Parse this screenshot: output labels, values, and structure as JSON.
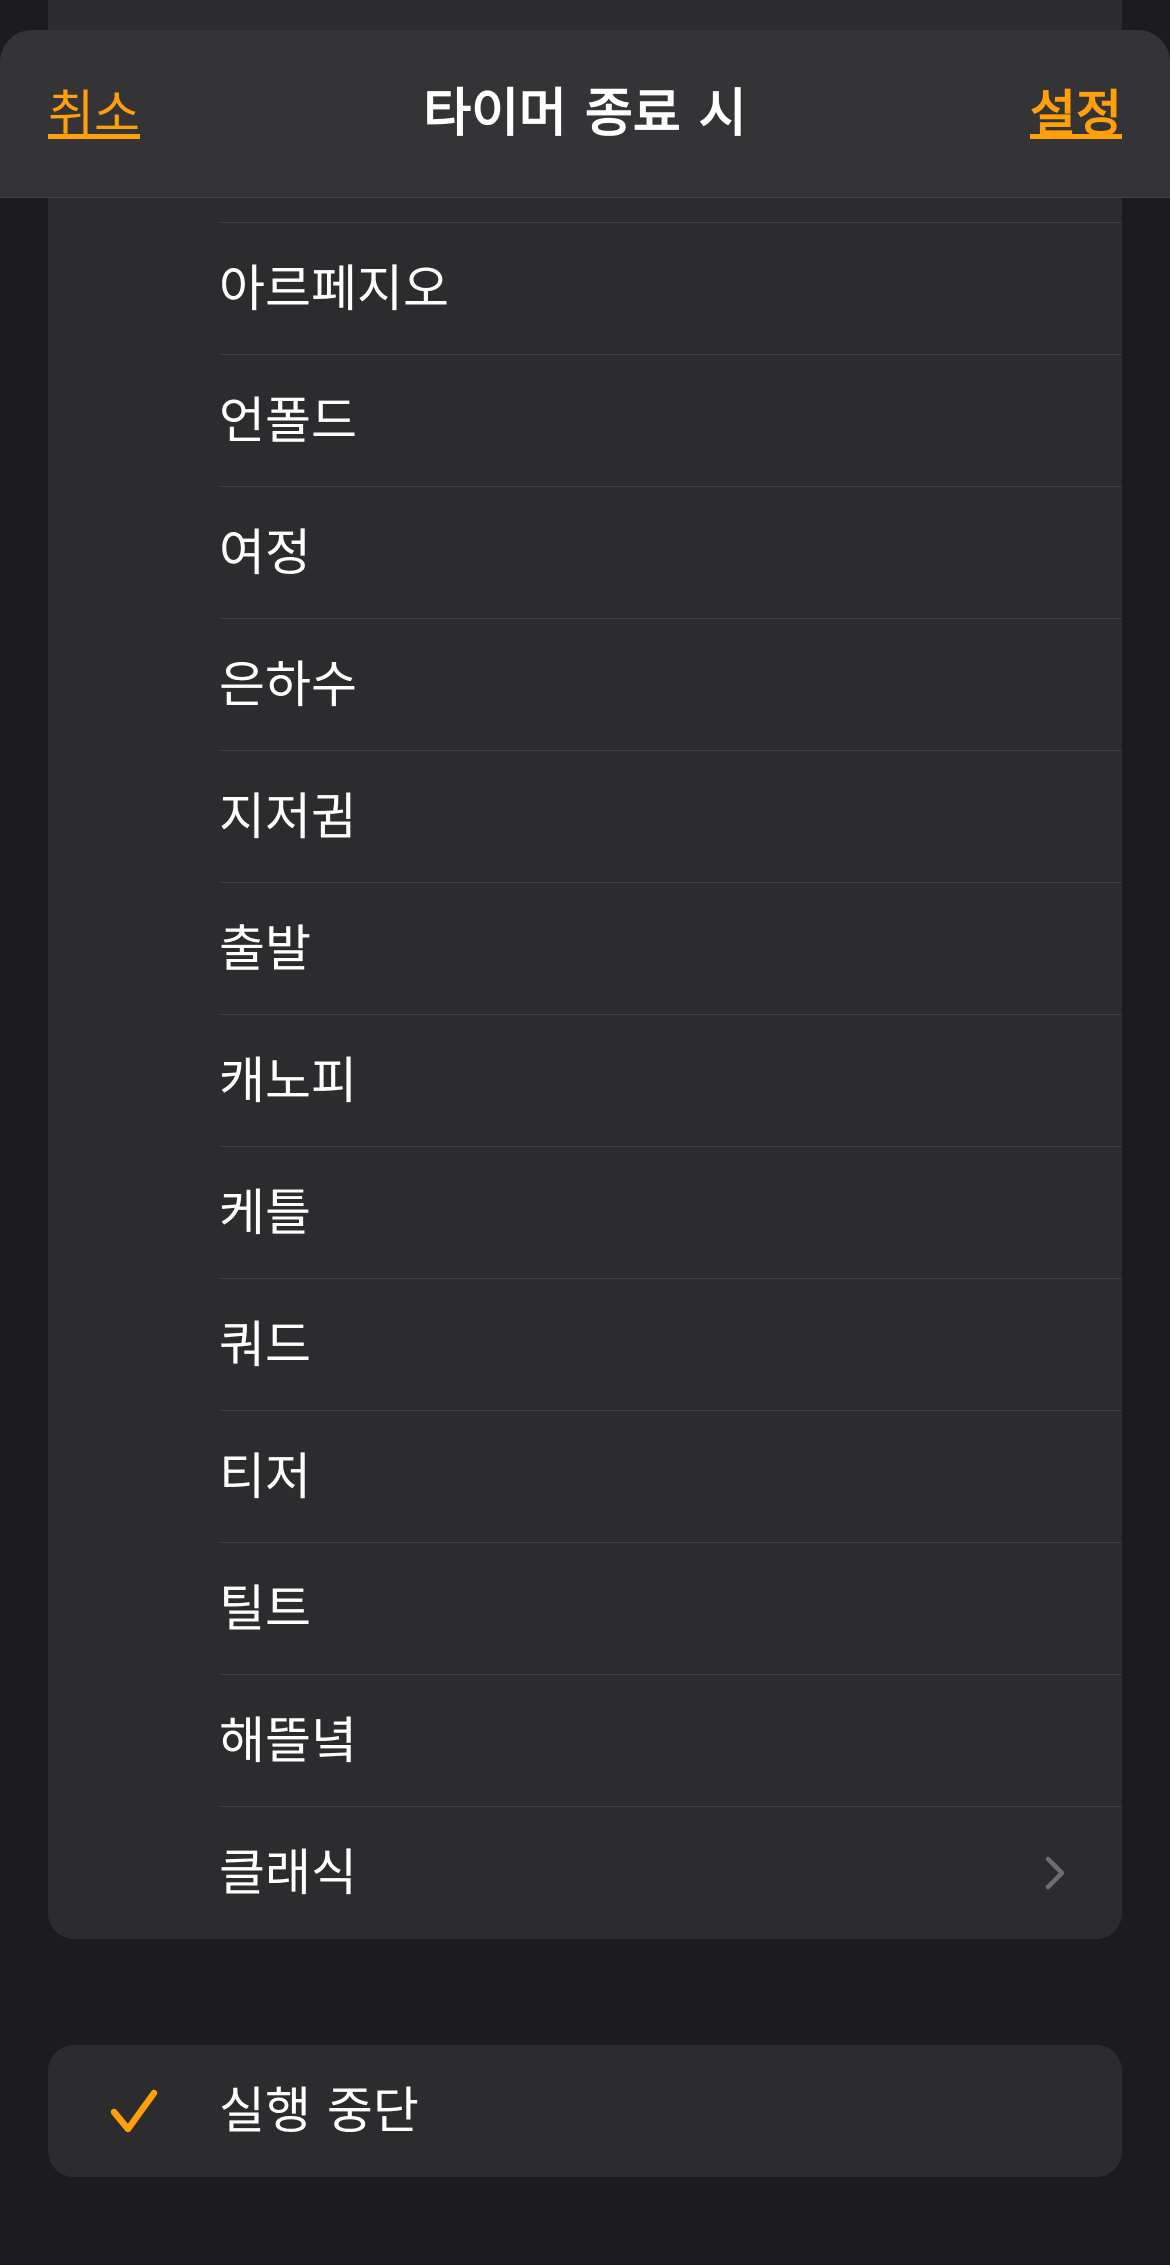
{
  "nav": {
    "title": "타이머 종료 시",
    "cancel_label": "취소",
    "set_label": "설정"
  },
  "sound_list": {
    "items": [
      {
        "label": "아르페지오"
      },
      {
        "label": "언폴드"
      },
      {
        "label": "여정"
      },
      {
        "label": "은하수"
      },
      {
        "label": "지저귐"
      },
      {
        "label": "출발"
      },
      {
        "label": "캐노피"
      },
      {
        "label": "케틀"
      },
      {
        "label": "쿼드"
      },
      {
        "label": "티저"
      },
      {
        "label": "틸트"
      },
      {
        "label": "해뜰녘"
      },
      {
        "label": "클래식",
        "icon": "chevron-right-icon"
      }
    ]
  },
  "stop_option": {
    "label": "실행 중단",
    "selected": true,
    "icon": "checkmark-icon"
  },
  "colors": {
    "accent": "#ff9f0a",
    "background": "#1c1c1e",
    "cell": "#2c2c2e",
    "nav_bar": "#343436",
    "separator": "#3d3d40",
    "chevron": "#6d6d72"
  }
}
